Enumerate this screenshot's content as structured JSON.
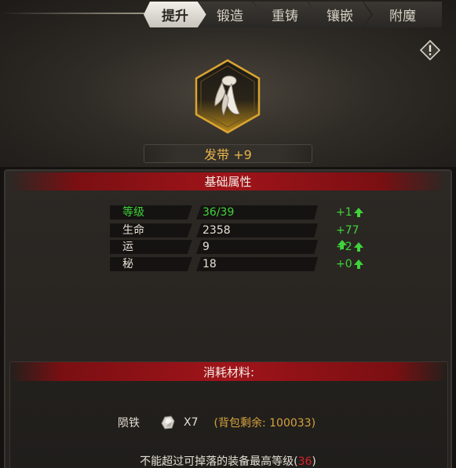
{
  "tabs": [
    {
      "label": "提升",
      "active": true
    },
    {
      "label": "锻造",
      "active": false
    },
    {
      "label": "重铸",
      "active": false
    },
    {
      "label": "镶嵌",
      "active": false
    },
    {
      "label": "附魔",
      "active": false
    }
  ],
  "item": {
    "name": "发带 +9",
    "icon": "headband-icon"
  },
  "info_button": {
    "icon": "exclamation-diamond-icon"
  },
  "stats_panel": {
    "title": "基础属性",
    "rows": [
      {
        "label": "等级",
        "value": "36/39",
        "increase": "+1",
        "highlight": true
      },
      {
        "label": "生命",
        "value": "2358",
        "increase": "+77",
        "highlight": false
      },
      {
        "label": "运",
        "value": "9",
        "increase": "+2",
        "highlight": false
      },
      {
        "label": "秘",
        "value": "18",
        "increase": "+0",
        "highlight": false
      }
    ]
  },
  "materials_panel": {
    "title": "消耗材料:",
    "material": {
      "name": "陨铁",
      "icon": "meteoric-iron-icon",
      "quantity": "X7",
      "bag_remaining": "(背包剩余: 100033)"
    },
    "limit_note_prefix": "不能超过可掉落的装备最高等级(",
    "limit_level": "36",
    "limit_note_suffix": ")"
  },
  "colors": {
    "accent_gold": "#e8b44a",
    "increase_green": "#3fd43a",
    "header_red": "#a0141a",
    "limit_red": "#d8222a"
  }
}
